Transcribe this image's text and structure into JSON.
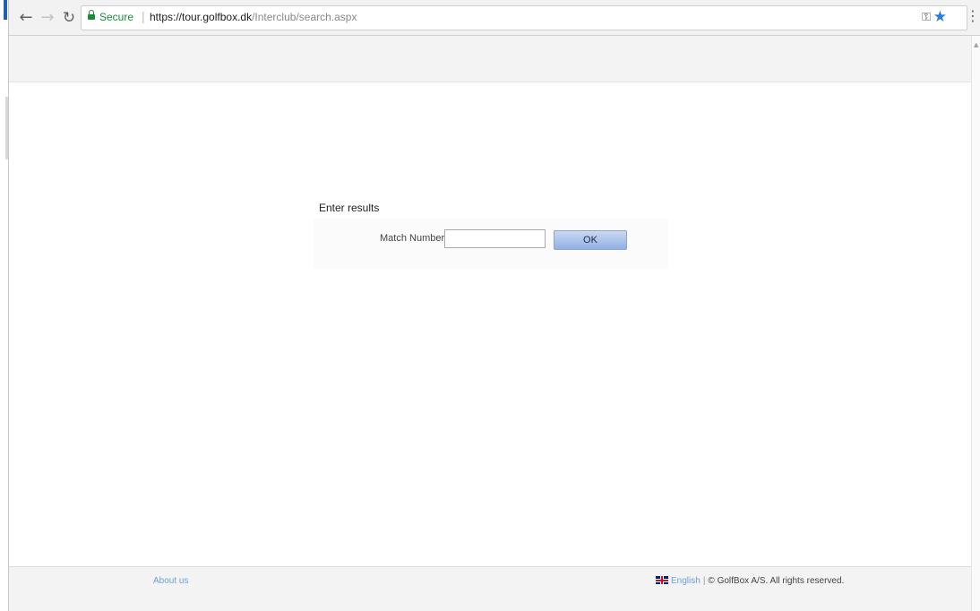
{
  "browser": {
    "secure_label": "Secure",
    "url_host": "https://tour.golfbox.dk",
    "url_path": "/Interclub/search.aspx",
    "icons": {
      "back": "arrow-left-icon",
      "forward": "arrow-right-icon",
      "reload": "reload-icon",
      "lock": "lock-icon",
      "key": "key-icon",
      "bookmark": "star-icon",
      "menu": "vertical-dots-icon"
    },
    "colors": {
      "secure_green": "#1e8a3c",
      "bookmark_blue": "#2a7bde"
    }
  },
  "form": {
    "title": "Enter results",
    "match_label": "Match Number:",
    "match_value": "",
    "ok_label": "OK"
  },
  "footer": {
    "about_label": "About us",
    "language_label": "English",
    "separator": "|",
    "copyright": "© GolfBox A/S. All rights reserved.",
    "flag_icon": "uk-flag-icon"
  }
}
